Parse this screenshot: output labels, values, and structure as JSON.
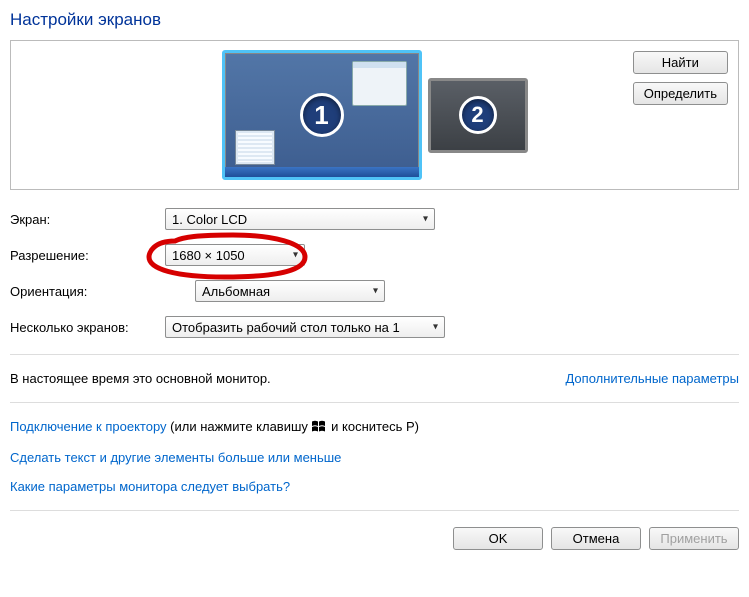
{
  "title": "Настройки экранов",
  "monitors": {
    "m1": "1",
    "m2": "2"
  },
  "buttons": {
    "find": "Найти",
    "identify": "Определить",
    "ok": "OK",
    "cancel": "Отмена",
    "apply": "Применить"
  },
  "labels": {
    "display": "Экран:",
    "resolution": "Разрешение:",
    "orientation": "Ориентация:",
    "multiple": "Несколько экранов:"
  },
  "values": {
    "display": "1. Color LCD",
    "resolution": "1680 × 1050",
    "orientation": "Альбомная",
    "multiple": "Отобразить рабочий стол только на 1"
  },
  "status": {
    "primary": "В настоящее время это основной монитор.",
    "advanced": "Дополнительные параметры"
  },
  "links": {
    "projector": "Подключение к проектору",
    "projector_suffix_pre": " (или нажмите клавишу ",
    "projector_suffix_post": " и коснитесь P)",
    "textsize": "Сделать текст и другие элементы больше или меньше",
    "help": "Какие параметры монитора следует выбрать?"
  }
}
